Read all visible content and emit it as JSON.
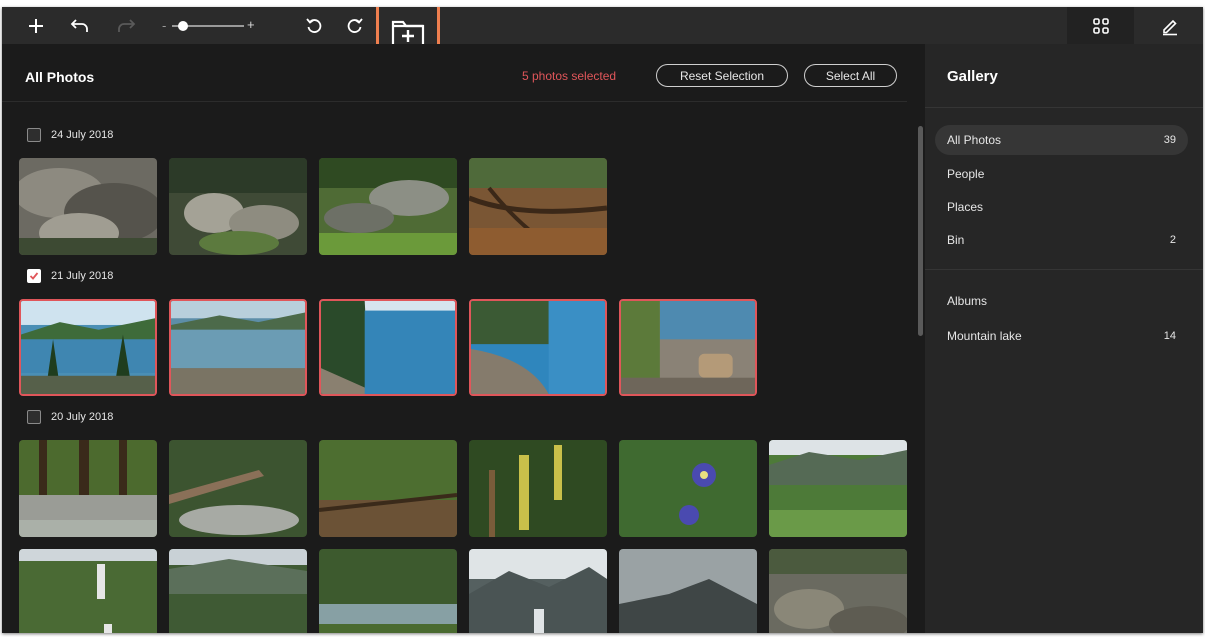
{
  "toolbar": {
    "icons": [
      "plus-icon",
      "undo-icon",
      "redo-icon",
      "zoom-slider",
      "rotate-left-icon",
      "rotate-right-icon",
      "new-album-icon",
      "grid-view-icon",
      "edit-icon"
    ],
    "zoom_level": 0.15,
    "highlight_color": "#ef7f4f"
  },
  "main": {
    "title": "All Photos",
    "selection_text": "5 photos selected",
    "reset_label": "Reset Selection",
    "select_all_label": "Select All",
    "accent": "#e0565a",
    "groups": [
      {
        "date": "24 July 2018",
        "checked": false
      },
      {
        "date": "21 July 2018",
        "checked": true
      },
      {
        "date": "20 July 2018",
        "checked": false
      }
    ]
  },
  "sidebar": {
    "title": "Gallery",
    "items": [
      {
        "label": "All Photos",
        "count": "39"
      },
      {
        "label": "People",
        "count": ""
      },
      {
        "label": "Places",
        "count": ""
      },
      {
        "label": "Bin",
        "count": "2"
      }
    ],
    "albums_heading": "Albums",
    "albums": [
      {
        "label": "Mountain lake",
        "count": "14"
      }
    ]
  }
}
